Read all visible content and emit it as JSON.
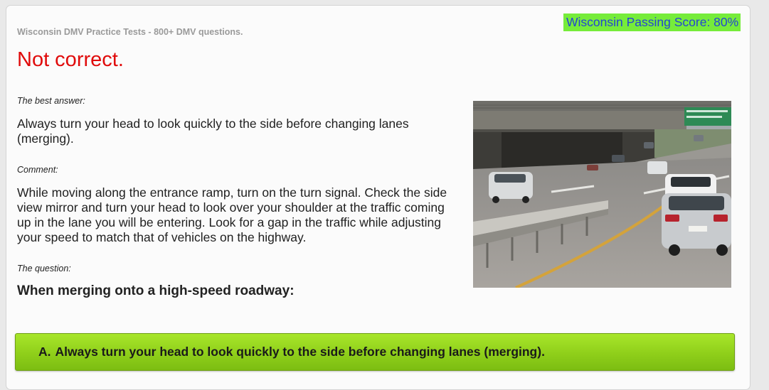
{
  "header": {
    "passing_score": "Wisconsin Passing Score: 80%",
    "site_title": "Wisconsin DMV Practice Tests - 800+ DMV questions."
  },
  "result": {
    "status": "Not correct."
  },
  "best_answer": {
    "label": "The best answer:",
    "text": "Always turn your head to look quickly to the side before changing lanes (merging)."
  },
  "comment": {
    "label": "Comment:",
    "text": "While moving along the entrance ramp, turn on the turn signal. Check the side view mirror and turn your head to look over your shoulder at the traffic coming up in the lane you will be entering. Look for a gap in the traffic while adjusting your speed to match that of vehicles on the highway."
  },
  "question": {
    "label": "The question:",
    "text": "When merging onto a high-speed roadway:"
  },
  "image": {
    "description_icon": "highway-merge-photo"
  },
  "options": [
    {
      "letter": "A.",
      "text": "Always turn your head to look quickly to the side before changing lanes (merging)."
    }
  ],
  "colors": {
    "result_incorrect": "#e00b0b",
    "score_badge_bg": "#76ec3a",
    "score_badge_text": "#2346d2",
    "option_green": "#8fcf1a"
  }
}
